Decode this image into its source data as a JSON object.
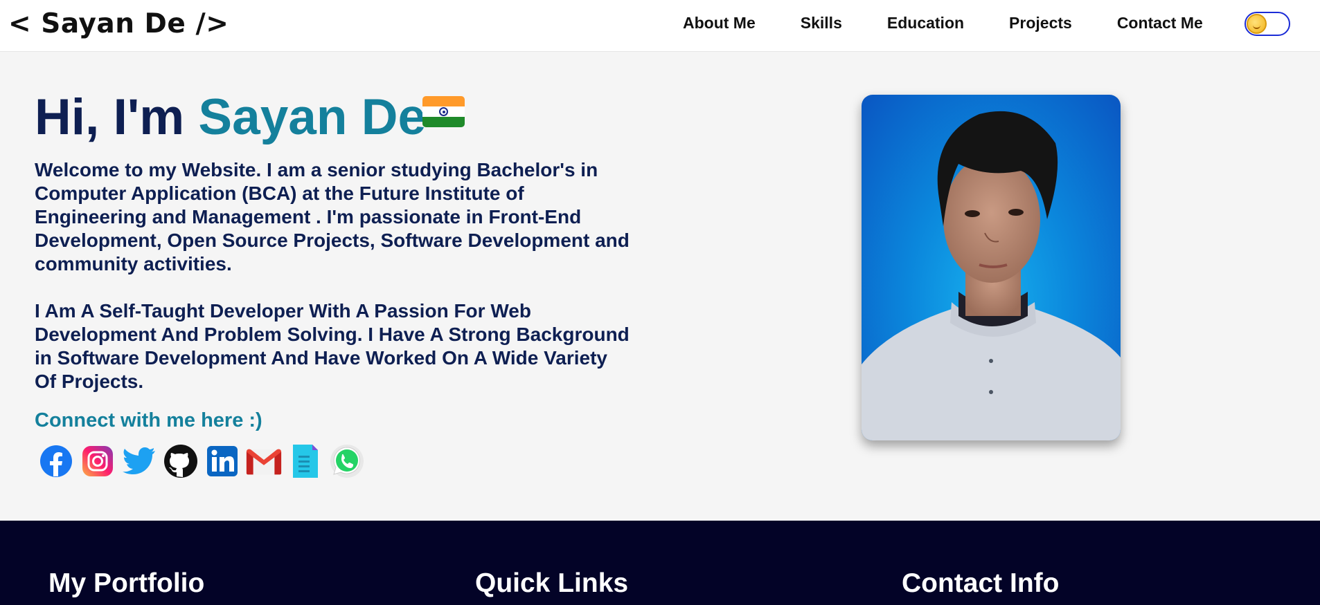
{
  "header": {
    "logo": "< Sayan De />",
    "nav": [
      "About Me",
      "Skills",
      "Education",
      "Projects",
      "Contact Me"
    ],
    "theme_toggle_icon": "sun-icon"
  },
  "hero": {
    "greeting": "Hi, I'm",
    "name": "Sayan De",
    "flag_icon": "india-flag-icon",
    "paragraph1": "Welcome to my Website. I am a senior studying Bachelor's in Computer Application (BCA) at the Future Institute of Engineering and Management . I'm passionate in Front-End Development, Open Source Projects, Software Development and community activities.",
    "paragraph2": "I Am A Self-Taught Developer With A Passion For Web Development And Problem Solving. I Have A Strong Background in Software Development And Have Worked On A Wide Variety Of Projects.",
    "connect": "Connect with me here :)",
    "socials": [
      "facebook-icon",
      "instagram-icon",
      "twitter-icon",
      "github-icon",
      "linkedin-icon",
      "gmail-icon",
      "document-icon",
      "whatsapp-icon"
    ]
  },
  "footer": {
    "col1": "My Portfolio",
    "col2": "Quick Links",
    "col3": "Contact Info"
  },
  "colors": {
    "navy": "#0e1f52",
    "accent": "#14809c",
    "footer_bg": "#030327",
    "page_bg": "#f5f5f5"
  }
}
